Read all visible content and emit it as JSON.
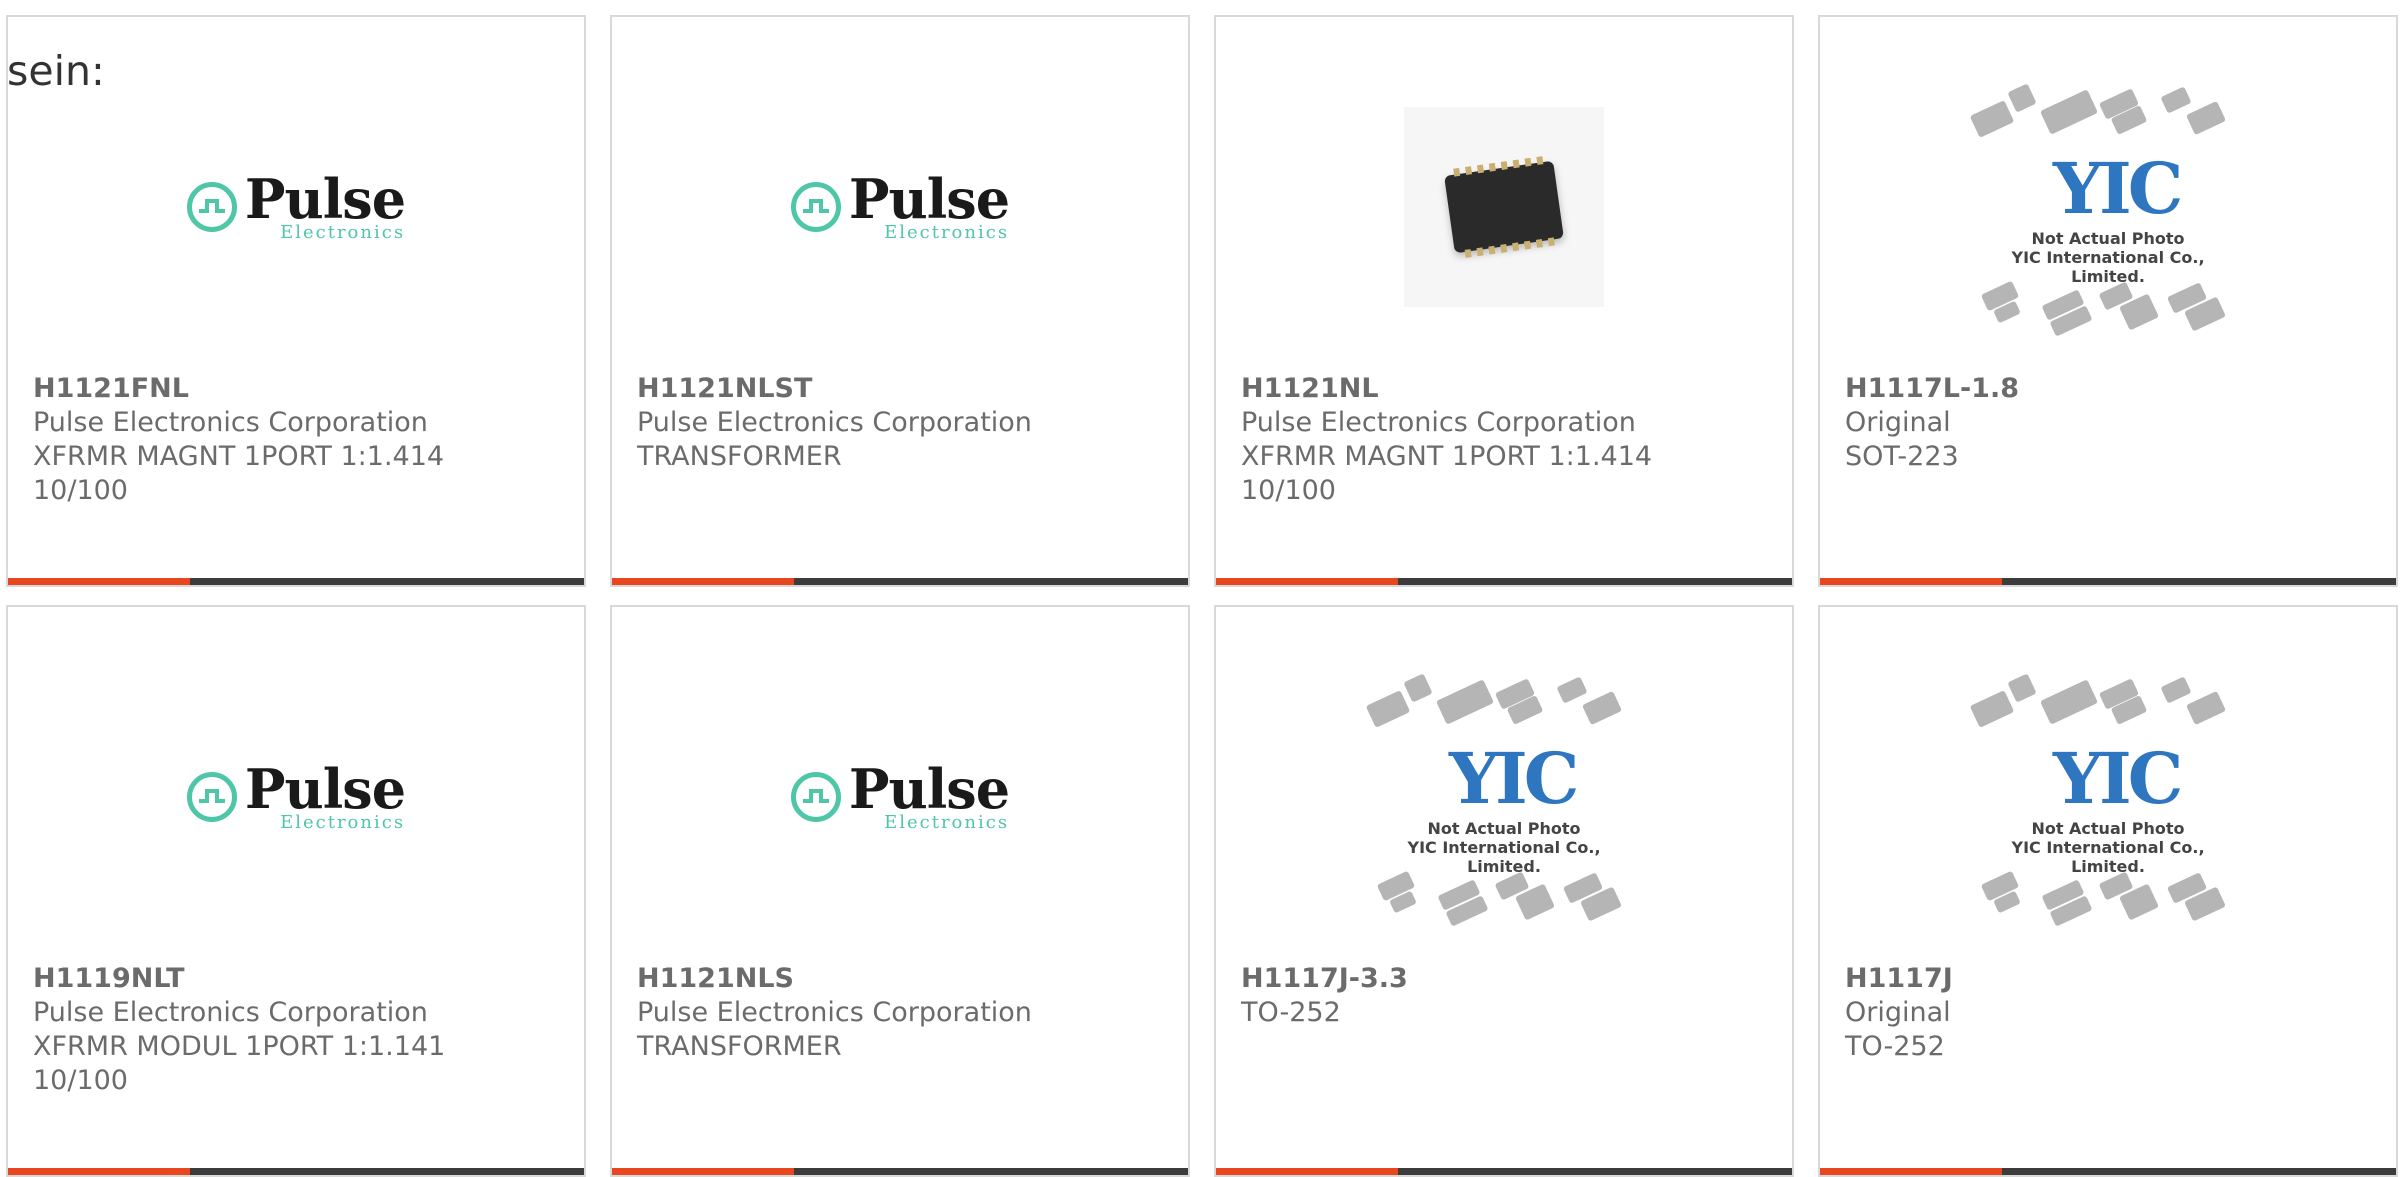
{
  "intro_text": "sein:",
  "colors": {
    "accent_bar": "#e8461e",
    "bar_dark": "#3c3c3c",
    "pulse_teal": "#4fc6a8",
    "yic_blue": "#2e76c0"
  },
  "logos": {
    "pulse": {
      "word": "Pulse",
      "sub": "Electronics"
    },
    "yic": {
      "mark": "YIC",
      "line1": "Not Actual Photo",
      "line2": "YIC International Co., Limited."
    }
  },
  "products": [
    {
      "pn": "H1121FNL",
      "image": "pulse-logo",
      "lines": [
        "Pulse Electronics Corporation",
        "XFRMR MAGNT 1PORT 1:1.414",
        "10/100"
      ]
    },
    {
      "pn": "H1121NLST",
      "image": "pulse-logo",
      "lines": [
        "Pulse Electronics Corporation",
        "TRANSFORMER"
      ]
    },
    {
      "pn": "H1121NL",
      "image": "chip-photo",
      "lines": [
        "Pulse Electronics Corporation",
        "XFRMR MAGNT 1PORT 1:1.414",
        "10/100"
      ]
    },
    {
      "pn": "H1117L-1.8",
      "image": "yic-placeholder",
      "lines": [
        "Original",
        "SOT-223"
      ]
    },
    {
      "pn": "H1119NLT",
      "image": "pulse-logo",
      "lines": [
        "Pulse Electronics Corporation",
        "XFRMR MODUL 1PORT 1:1.141",
        "10/100"
      ]
    },
    {
      "pn": "H1121NLS",
      "image": "pulse-logo",
      "lines": [
        "Pulse Electronics Corporation",
        "TRANSFORMER"
      ]
    },
    {
      "pn": "H1117J-3.3",
      "image": "yic-placeholder",
      "lines": [
        "TO-252"
      ]
    },
    {
      "pn": "H1117J",
      "image": "yic-placeholder",
      "lines": [
        "Original",
        "TO-252"
      ]
    }
  ]
}
